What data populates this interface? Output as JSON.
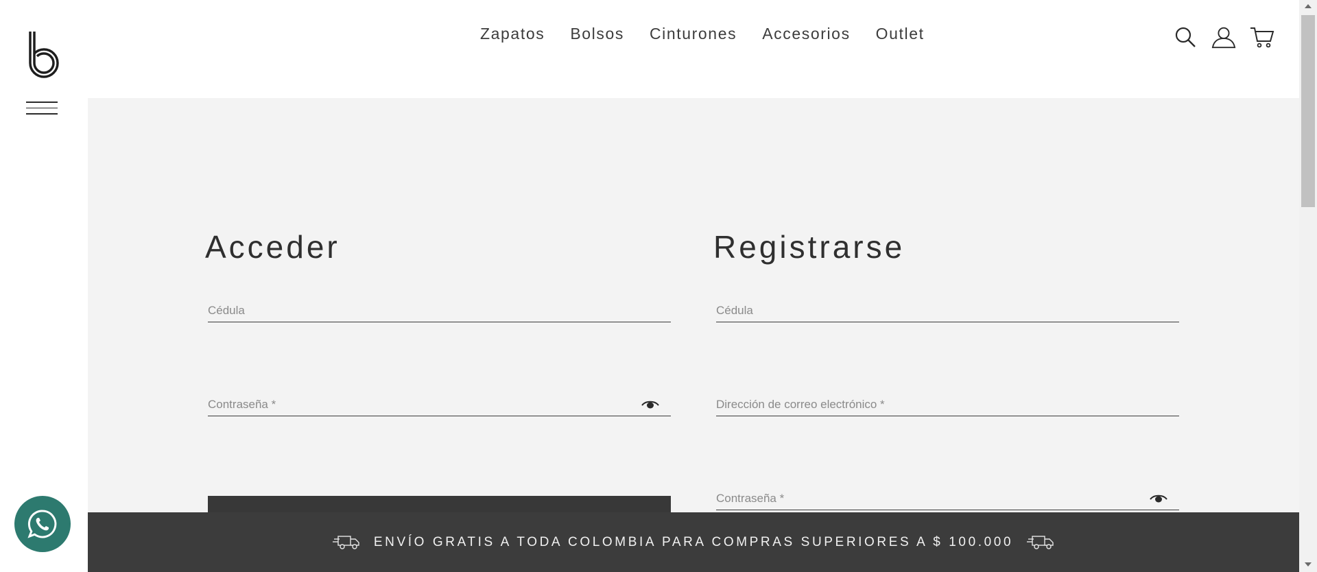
{
  "brand": {
    "logo_letter": "b"
  },
  "nav": {
    "items": [
      {
        "label": "Zapatos"
      },
      {
        "label": "Bolsos"
      },
      {
        "label": "Cinturones"
      },
      {
        "label": "Accesorios"
      },
      {
        "label": "Outlet"
      }
    ]
  },
  "header_icons": [
    "search-icon",
    "user-icon",
    "cart-icon"
  ],
  "login": {
    "title": "Acceder",
    "cedula_placeholder": "Cédula",
    "password_placeholder": "Contraseña *",
    "cedula_value": "",
    "password_value": ""
  },
  "register": {
    "title": "Registrarse",
    "cedula_placeholder": "Cédula",
    "email_placeholder": "Dirección de correo electrónico *",
    "password_placeholder": "Contraseña *",
    "cedula_value": "",
    "email_value": "",
    "password_value": ""
  },
  "banner": {
    "text": "ENVÍO GRATIS A TODA COLOMBIA PARA COMPRAS SUPERIORES A $ 100.000"
  },
  "colors": {
    "main_bg": "#f3f3f3",
    "banner_bg": "#3c3c3c",
    "whatsapp": "#2d7a6f",
    "text": "#3a3a3a"
  }
}
